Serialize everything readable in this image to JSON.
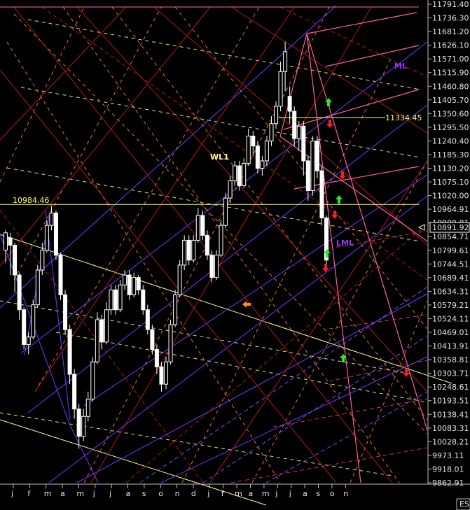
{
  "chart_data": {
    "type": "candlestick",
    "symbol": "ES",
    "ylim": [
      9862.91,
      11791.4
    ],
    "y_ticks": [
      "11791.40",
      "11736.30",
      "11681.20",
      "11626.10",
      "11571.00",
      "11515.90",
      "11460.80",
      "11405.70",
      "11350.60",
      "11295.50",
      "11240.40",
      "11185.30",
      "11130.20",
      "11075.10",
      "11020.00",
      "10964.91",
      "10909.81",
      "10854.71",
      "10799.61",
      "10744.51",
      "10689.41",
      "10634.31",
      "10579.21",
      "10524.11",
      "10469.01",
      "10413.91",
      "10358.81",
      "10303.71",
      "10248.61",
      "10193.51",
      "10138.41",
      "10083.31",
      "10028.21",
      "9973.11",
      "9918.01",
      "9862.91"
    ],
    "x_ticks": [
      "j",
      "f",
      "m",
      "a",
      "m",
      "j",
      "j",
      "a",
      "s",
      "o",
      "n",
      "d",
      "j",
      "f",
      "m",
      "a",
      "m",
      "j",
      "j",
      "a",
      "s",
      "o",
      "n"
    ],
    "current_price": "10891.92",
    "levels": [
      {
        "label": "10984.46",
        "value": 10984.46,
        "color": "#ffff66"
      },
      {
        "label": "11334.45",
        "value": 11334.45,
        "color": "#ffff66"
      },
      {
        "label": "",
        "value": 11780.0,
        "color": "#ff6aa8"
      }
    ],
    "annotations": [
      {
        "text": "ML",
        "color": "#9933ff"
      },
      {
        "text": "WL1",
        "color": "#ffff99"
      },
      {
        "text": "LML",
        "color": "#9933ff"
      }
    ],
    "arrows": [
      {
        "dir": "up",
        "color": "#22ee22"
      },
      {
        "dir": "down",
        "color": "#ee2222"
      },
      {
        "dir": "down",
        "color": "#ee2222"
      },
      {
        "dir": "up",
        "color": "#22ee22"
      },
      {
        "dir": "down",
        "color": "#ee2222"
      },
      {
        "dir": "up",
        "color": "#22ee22"
      },
      {
        "dir": "down",
        "color": "#ee2222"
      },
      {
        "dir": "up",
        "color": "#22ee22"
      },
      {
        "dir": "down",
        "color": "#ee2222"
      },
      {
        "dir": "left",
        "color": "#ff8c1a"
      }
    ],
    "candles": [
      [
        10800,
        10870,
        10750,
        10880
      ],
      [
        10850,
        10820,
        10700,
        10870
      ],
      [
        10820,
        10700,
        10630,
        10830
      ],
      [
        10700,
        10560,
        10520,
        10710
      ],
      [
        10560,
        10420,
        10400,
        10570
      ],
      [
        10420,
        10450,
        10380,
        10470
      ],
      [
        10450,
        10580,
        10440,
        10600
      ],
      [
        10580,
        10720,
        10570,
        10740
      ],
      [
        10720,
        10800,
        10700,
        10830
      ],
      [
        10800,
        10900,
        10790,
        10920
      ],
      [
        10900,
        10950,
        10880,
        10980
      ],
      [
        10950,
        10780,
        10760,
        10960
      ],
      [
        10780,
        10620,
        10600,
        10790
      ],
      [
        10620,
        10480,
        10460,
        10640
      ],
      [
        10480,
        10300,
        10260,
        10500
      ],
      [
        10300,
        10160,
        10120,
        10320
      ],
      [
        10160,
        10050,
        10000,
        10180
      ],
      [
        10050,
        10130,
        10030,
        10160
      ],
      [
        10130,
        10200,
        10110,
        10230
      ],
      [
        10200,
        10350,
        10190,
        10370
      ],
      [
        10350,
        10520,
        10340,
        10550
      ],
      [
        10520,
        10430,
        10400,
        10540
      ],
      [
        10430,
        10560,
        10420,
        10590
      ],
      [
        10560,
        10640,
        10540,
        10660
      ],
      [
        10640,
        10560,
        10540,
        10660
      ],
      [
        10560,
        10660,
        10550,
        10680
      ],
      [
        10660,
        10700,
        10640,
        10720
      ],
      [
        10700,
        10620,
        10600,
        10720
      ],
      [
        10620,
        10690,
        10610,
        10710
      ],
      [
        10690,
        10640,
        10620,
        10700
      ],
      [
        10640,
        10560,
        10540,
        10660
      ],
      [
        10560,
        10480,
        10460,
        10580
      ],
      [
        10480,
        10400,
        10380,
        10500
      ],
      [
        10400,
        10330,
        10300,
        10420
      ],
      [
        10330,
        10260,
        10230,
        10350
      ],
      [
        10260,
        10350,
        10240,
        10370
      ],
      [
        10350,
        10500,
        10340,
        10520
      ],
      [
        10500,
        10620,
        10490,
        10640
      ],
      [
        10620,
        10740,
        10610,
        10760
      ],
      [
        10740,
        10840,
        10720,
        10860
      ],
      [
        10840,
        10760,
        10740,
        10860
      ],
      [
        10760,
        10840,
        10750,
        10860
      ],
      [
        10840,
        10940,
        10830,
        10970
      ],
      [
        10940,
        10860,
        10840,
        10960
      ],
      [
        10860,
        10780,
        10760,
        10880
      ],
      [
        10780,
        10690,
        10670,
        10800
      ],
      [
        10690,
        10780,
        10680,
        10800
      ],
      [
        10780,
        10900,
        10770,
        10920
      ],
      [
        10900,
        11010,
        10890,
        11030
      ],
      [
        11010,
        11080,
        10990,
        11100
      ],
      [
        11080,
        11140,
        11060,
        11160
      ],
      [
        11140,
        11060,
        11040,
        11160
      ],
      [
        11060,
        11150,
        11050,
        11170
      ],
      [
        11150,
        11260,
        11140,
        11290
      ],
      [
        11260,
        11220,
        11180,
        11280
      ],
      [
        11220,
        11130,
        11110,
        11240
      ],
      [
        11130,
        11160,
        11100,
        11180
      ],
      [
        11160,
        11240,
        11140,
        11260
      ],
      [
        11240,
        11310,
        11220,
        11340
      ],
      [
        11310,
        11380,
        11290,
        11400
      ],
      [
        11380,
        11520,
        11360,
        11560
      ],
      [
        11520,
        11600,
        11440,
        11640
      ],
      [
        11420,
        11360,
        11310,
        11460
      ],
      [
        11360,
        11250,
        11220,
        11380
      ],
      [
        11250,
        11300,
        11200,
        11320
      ],
      [
        11300,
        11160,
        11100,
        11320
      ],
      [
        11160,
        11040,
        11000,
        11180
      ],
      [
        11040,
        11240,
        11020,
        11260
      ],
      [
        11240,
        11120,
        11090,
        11260
      ],
      [
        11120,
        10930,
        10900,
        11140
      ],
      [
        10930,
        10760,
        10740,
        10940
      ]
    ]
  }
}
